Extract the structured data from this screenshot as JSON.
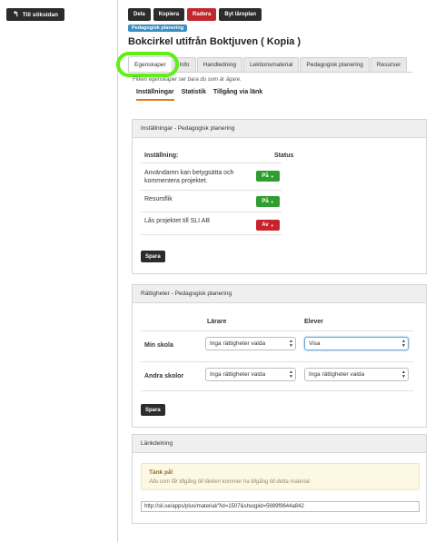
{
  "nav": {
    "back_label": "Till söksidan"
  },
  "toolbar": {
    "share": "Dela",
    "copy": "Kopiera",
    "delete": "Radera",
    "change_curriculum": "Byt läroplan"
  },
  "badge": "Pedagogisk planering",
  "title": "Bokcirkel utifrån Boktjuven ( Kopia )",
  "tabs": [
    "Egenskaper",
    "Info",
    "Handledning",
    "Lektionsmaterial",
    "Pedagogisk planering",
    "Resurser"
  ],
  "subtitle": "Fliken egenskaper ser bara du som är ägare.",
  "subtabs": [
    "Inställningar",
    "Statistik",
    "Tillgång via länk"
  ],
  "settings_panel": {
    "title": "Inställningar - Pedagogisk planering",
    "col_setting": "Inställning:",
    "col_status": "Status",
    "rows": [
      {
        "label_line1": "Användaren kan betygsätta och",
        "label_line2": "kommentera projektet.",
        "status": "På"
      },
      {
        "label": "Resursflik",
        "status": "På"
      },
      {
        "label": "Lås projektet till SLI AB",
        "status": "Av"
      }
    ],
    "save": "Spara"
  },
  "rights_panel": {
    "title": "Rättigheter - Pedagogisk planering",
    "col_teachers": "Lärare",
    "col_students": "Elever",
    "rows": [
      {
        "label": "Min skola",
        "teachers": "Inga rättigheter valda",
        "students": "Visa"
      },
      {
        "label": "Andra skolor",
        "teachers": "Inga rättigheter valda",
        "students": "Inga rättigheter valda"
      }
    ],
    "save": "Spara"
  },
  "link_panel": {
    "title": "Länkdelning",
    "notice_title": "Tänk på!",
    "notice_body": "Alla som får tillgång till länken kommer ha tillgång till detta material.",
    "url": "http://sli.se/apps/plus/material/?id=1507&shuqpid=5989f9644a842"
  },
  "colors": {
    "accent_orange": "#e07b1d",
    "on_green": "#2f9e2f",
    "off_red": "#c8222a",
    "badge_blue": "#3a8fc4",
    "highlight_ring": "#5ef012"
  },
  "icons": {
    "back": "back-arrow-icon",
    "select_chevron": "chevron-updown-icon",
    "pill_caret": "caret-down-icon"
  }
}
